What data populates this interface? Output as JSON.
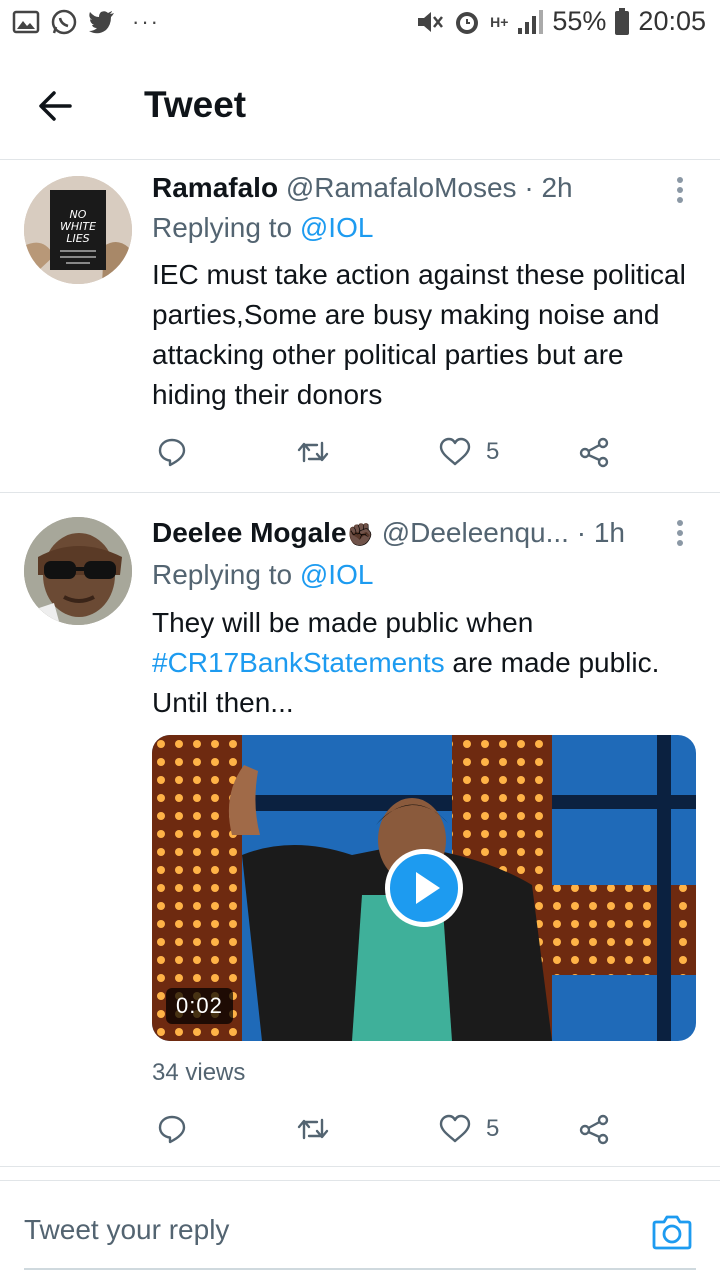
{
  "status_bar": {
    "icons": [
      "gallery-icon",
      "whatsapp-icon",
      "twitter-icon"
    ],
    "more": "···",
    "network": "H+",
    "battery": "55%",
    "time": "20:05"
  },
  "header": {
    "title": "Tweet",
    "back_icon": "arrow-left-icon"
  },
  "tweets": [
    {
      "name": "Ramafalo",
      "handle": "@RamafaloMoses",
      "time": "· 2h",
      "replying_prefix": "Replying to",
      "replying_to": "@IOL",
      "text": "IEC must take action against these political parties,Some are busy making noise and attacking other political parties but are hiding their donors",
      "avatar_text": "NO WHITE LIES",
      "likes": "5"
    },
    {
      "name": "Deelee Mogale",
      "name_emoji": "✊🏿",
      "handle": "@Deeleenqu...",
      "time": "· 1h",
      "replying_prefix": "Replying to",
      "replying_to": "@IOL",
      "text_before": "They will be made public when",
      "hashtag": "#CR17BankStatements",
      "text_after": "are made public. Until then...",
      "video_duration": "0:02",
      "views": "34 views",
      "likes": "5"
    }
  ],
  "reply_bar": {
    "placeholder": "Tweet your reply",
    "camera_icon": "camera-icon"
  },
  "colors": {
    "accent": "#1d9bf0",
    "secondary_text": "#536471",
    "primary_text": "#0f1419"
  }
}
